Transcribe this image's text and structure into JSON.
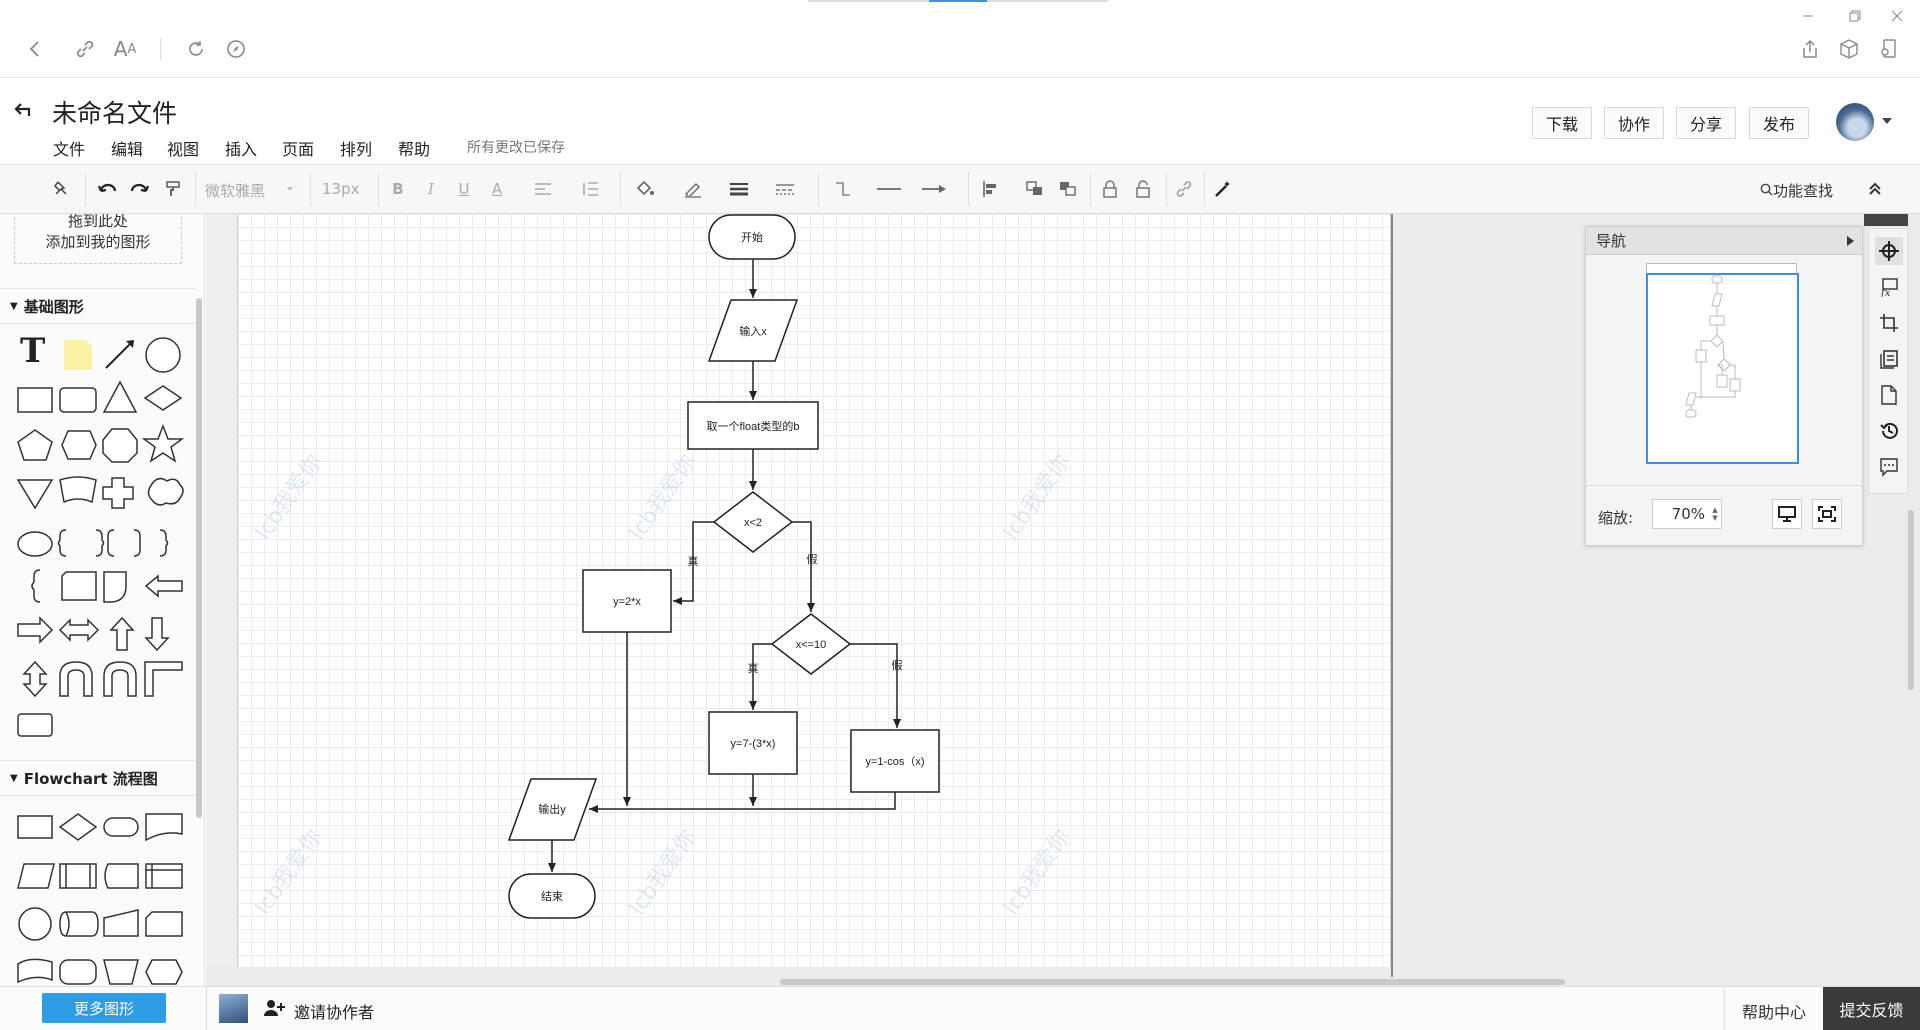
{
  "doc": {
    "title": "未命名文件",
    "menu": [
      "文件",
      "编辑",
      "视图",
      "插入",
      "页面",
      "排列",
      "帮助"
    ],
    "save_status": "所有更改已保存",
    "actions": {
      "download": "下载",
      "collab": "协作",
      "share": "分享",
      "publish": "发布"
    }
  },
  "toolbar": {
    "font_family": "微软雅黑",
    "font_size": "13px",
    "search_label": "功能查找"
  },
  "left_panel": {
    "drop_hint_line1": "拖到此处",
    "drop_hint_line2": "添加到我的图形",
    "section_basic": "基础图形",
    "section_flowchart": "Flowchart 流程图",
    "more_shapes": "更多图形"
  },
  "flowchart": {
    "start": "开始",
    "input": "输入x",
    "take": "取一个float类型的b",
    "cond1": "x<2",
    "cond1_true": "真",
    "cond1_false": "假",
    "box1": "y=2*x",
    "cond2": "x<=10",
    "cond2_true": "真",
    "cond2_false": "假",
    "box2": "y=7-(3*x)",
    "box3": "y=1-cos（x)",
    "output": "输出y",
    "end": "结束"
  },
  "watermark": "lcb我爱你",
  "navigator": {
    "title": "导航",
    "zoom_label": "缩放:",
    "zoom_value": "70%"
  },
  "bottom": {
    "invite": "邀请协作者",
    "help": "帮助中心",
    "feedback": "提交反馈"
  },
  "colors": {
    "accent": "#2d9ee6",
    "feedback_bg": "#3a3a3a",
    "nav_highlight": "#3c8ee6"
  }
}
